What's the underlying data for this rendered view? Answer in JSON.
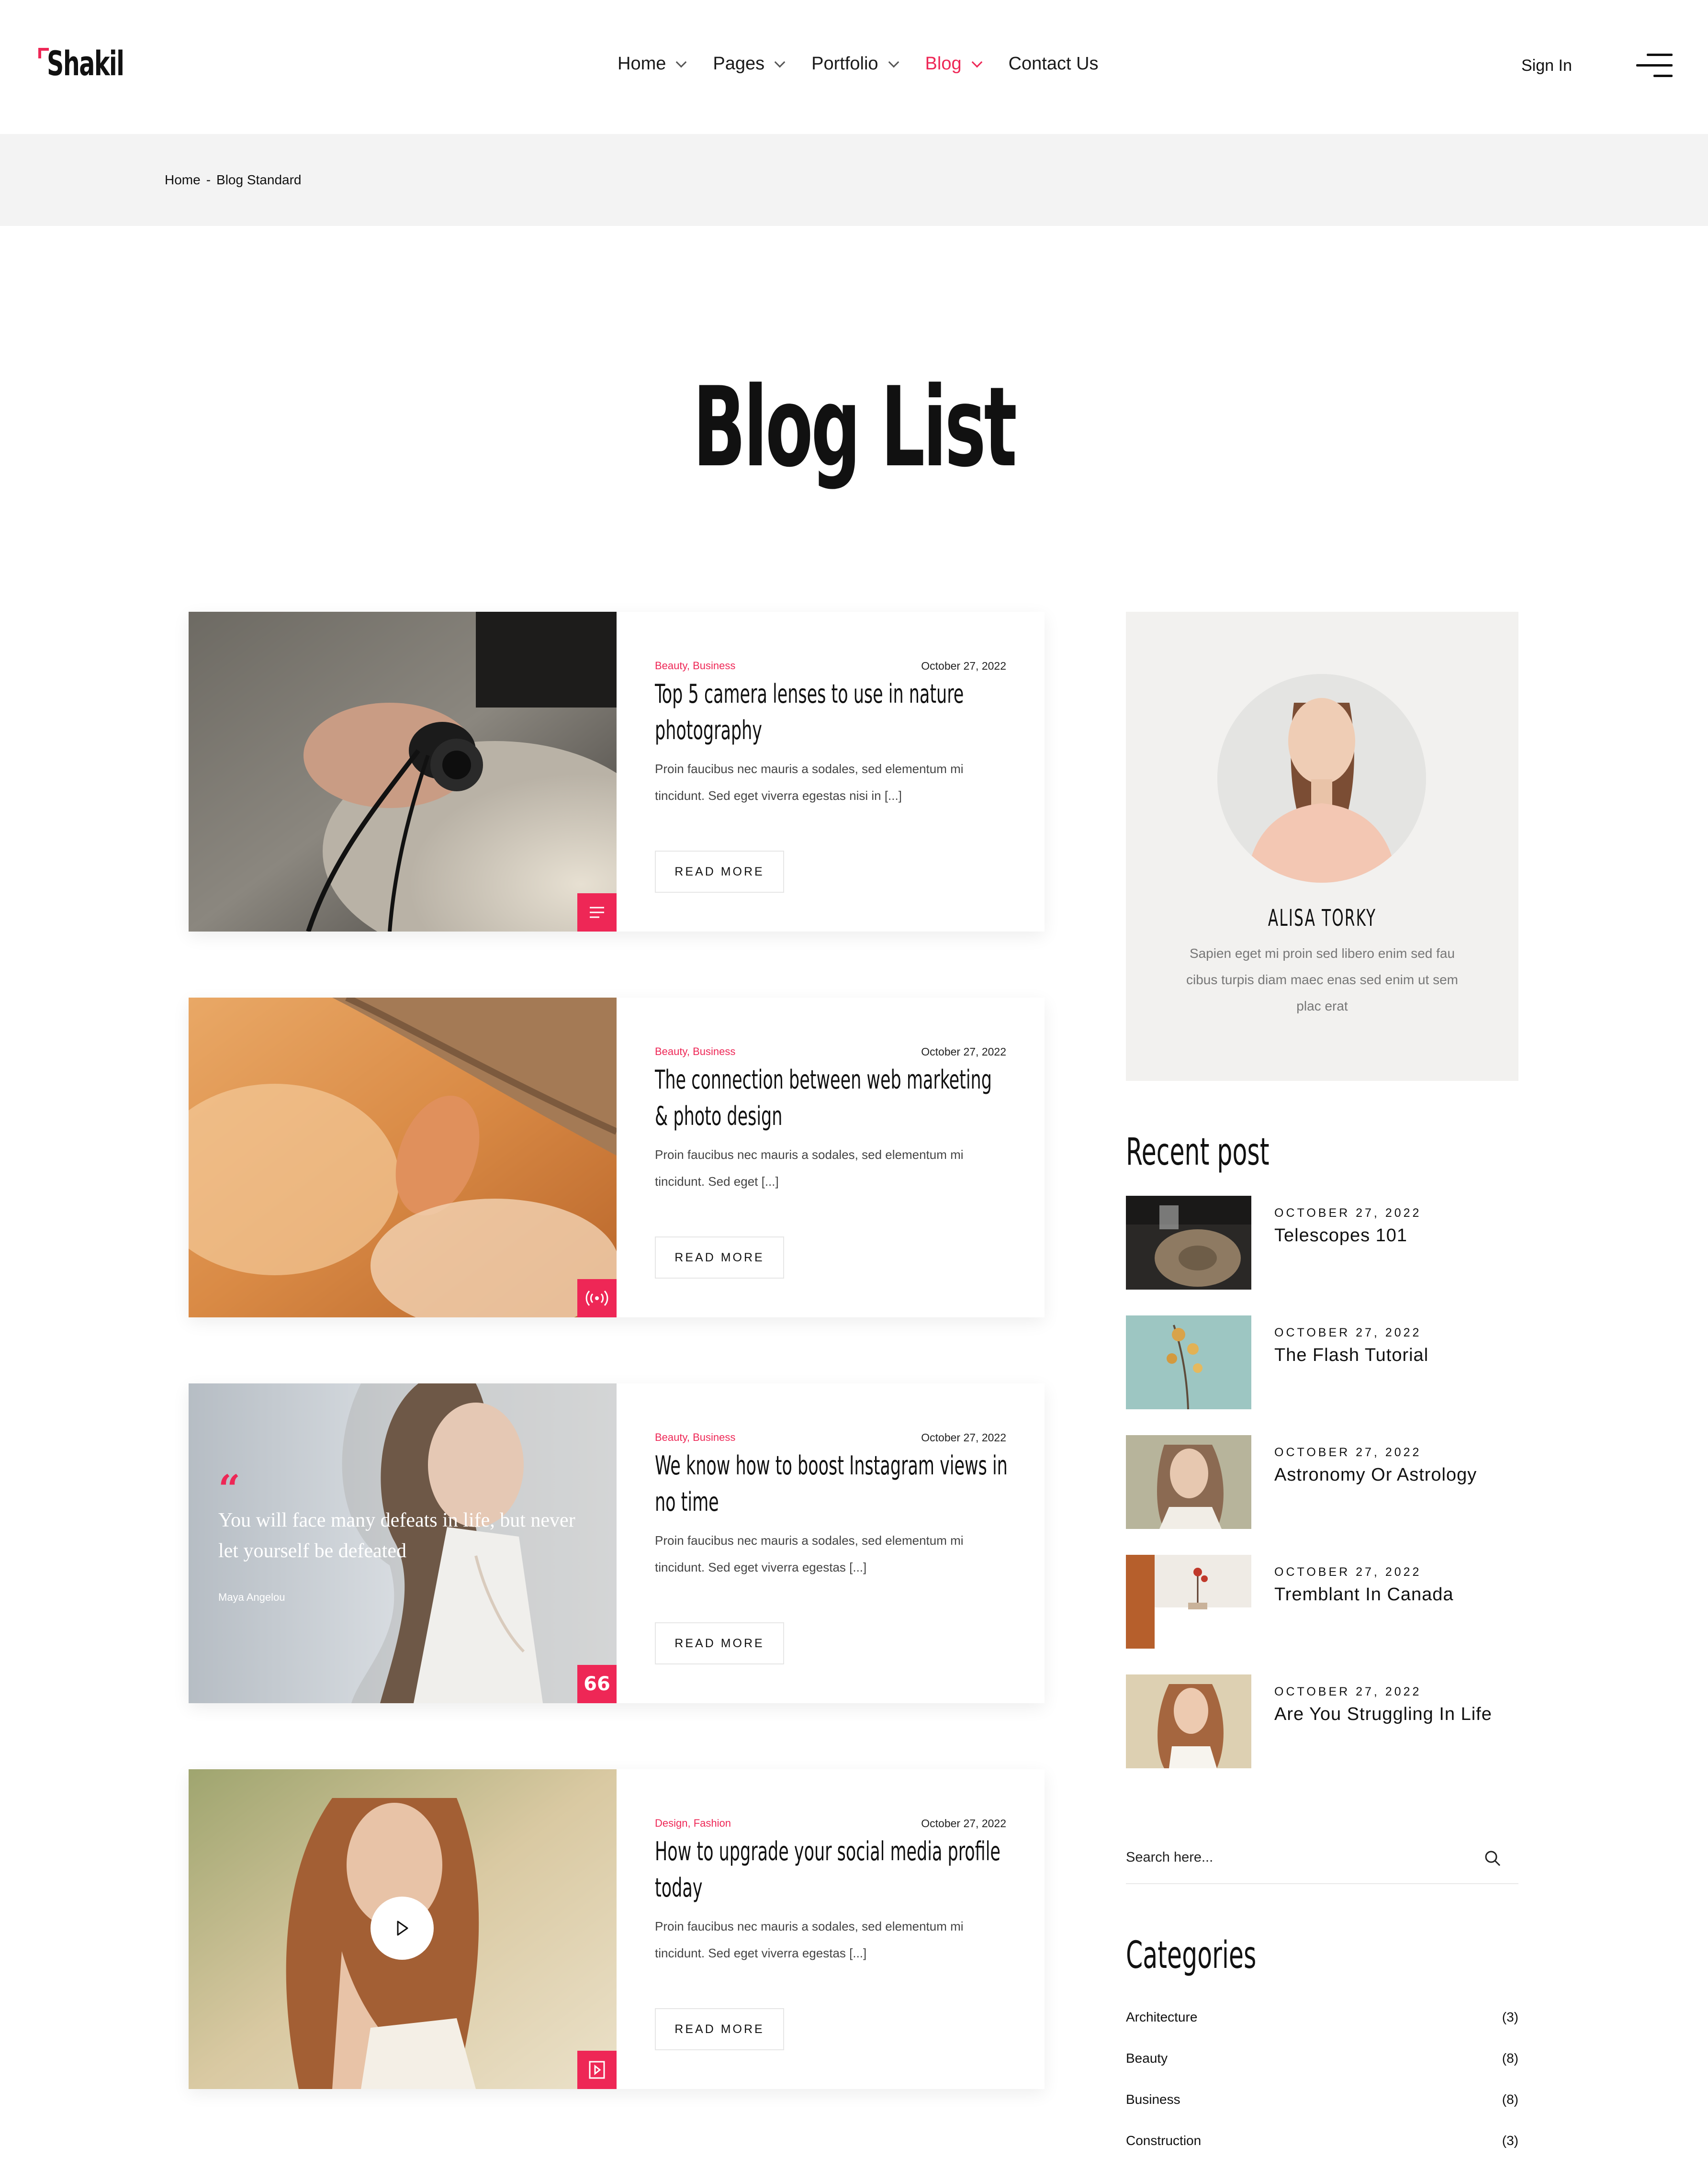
{
  "brand": {
    "name": "Shakil",
    "accent": "#ee2756"
  },
  "nav": {
    "items": [
      {
        "label": "Home",
        "dropdown": true,
        "active": false
      },
      {
        "label": "Pages",
        "dropdown": true,
        "active": false
      },
      {
        "label": "Portfolio",
        "dropdown": true,
        "active": false
      },
      {
        "label": "Blog",
        "dropdown": true,
        "active": true
      },
      {
        "label": "Contact Us",
        "dropdown": false,
        "active": false
      }
    ],
    "signin": "Sign In",
    "menu_icon": "hamburger-icon"
  },
  "breadcrumb": {
    "home": "Home",
    "separator": "-",
    "current": "Blog Standard"
  },
  "page": {
    "title": "Blog List"
  },
  "posts": [
    {
      "categories": "Beauty, Business",
      "date": "October 27, 2022",
      "title": "Top 5 camera lenses to use in nature photography",
      "excerpt": "Proin faucibus nec mauris a sodales, sed elementum mi tincidunt. Sed eget viverra egestas nisi in [...]",
      "read_more": "READ MORE",
      "format_icon": "text-lines-icon"
    },
    {
      "categories": "Beauty, Business",
      "date": "October 27, 2022",
      "title": "The connection between web marketing & photo design",
      "excerpt": "Proin faucibus nec mauris a sodales, sed elementum mi tincidunt. Sed eget [...]",
      "read_more": "READ MORE",
      "format_icon": "audio-broadcast-icon"
    },
    {
      "categories": "Beauty, Business",
      "date": "October 27, 2022",
      "title": "We know how to boost Instagram views in no time",
      "excerpt": "Proin faucibus nec mauris a sodales, sed elementum mi tincidunt. Sed eget viverra egestas [...]",
      "read_more": "READ MORE",
      "format_icon": "quote-icon",
      "quote": {
        "text": "You will face many defeats in life, but never let yourself be defeated",
        "author": "Maya Angelou"
      }
    },
    {
      "categories": "Design, Fashion",
      "date": "October 27, 2022",
      "title": "How to upgrade your social media profile today",
      "excerpt": "Proin faucibus nec mauris a sodales, sed elementum mi tincidunt. Sed eget viverra egestas [...]",
      "read_more": "READ MORE",
      "format_icon": "video-icon"
    }
  ],
  "sidebar": {
    "author": {
      "name": "ALISA TORKY",
      "bio": "Sapien eget mi proin sed libero enim sed fau cibus turpis diam maec enas sed enim ut sem plac erat"
    },
    "recent_title": "Recent post",
    "recent": [
      {
        "date": "OCTOBER 27, 2022",
        "title": "Telescopes 101"
      },
      {
        "date": "OCTOBER 27, 2022",
        "title": "The Flash Tutorial"
      },
      {
        "date": "OCTOBER 27, 2022",
        "title": "Astronomy Or Astrology"
      },
      {
        "date": "OCTOBER 27, 2022",
        "title": "Tremblant In Canada"
      },
      {
        "date": "OCTOBER 27, 2022",
        "title": "Are You Struggling In Life"
      }
    ],
    "search": {
      "placeholder": "Search here..."
    },
    "categories_title": "Categories",
    "categories": [
      {
        "name": "Architecture",
        "count": "(3)"
      },
      {
        "name": "Beauty",
        "count": "(8)"
      },
      {
        "name": "Business",
        "count": "(8)"
      },
      {
        "name": "Construction",
        "count": "(3)"
      }
    ]
  }
}
